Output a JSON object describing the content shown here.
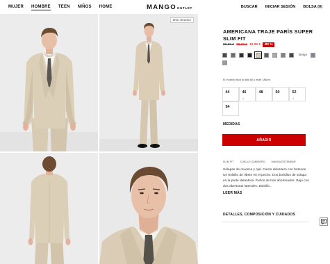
{
  "header": {
    "nav": [
      "MUJER",
      "HOMBRE",
      "TEEN",
      "NIÑOS",
      "HOME"
    ],
    "active_nav": "HOMBRE",
    "logo": "MANGO",
    "logo_suffix": "OUTLET",
    "search": "BUSCAR",
    "login": "INICIAR SESIÓN",
    "bag": "BOLSA (0)"
  },
  "gallery": {
    "badge": "BRID VENDIDO"
  },
  "product": {
    "title": "AMERICANA TRAJE PARÍS SUPER SLIM FIT",
    "price_original": "99,99 €",
    "price_previous": "79,99 €",
    "price_current": "19,99 €",
    "discount": "-80 %",
    "colors": [
      "#4a4a4a",
      "#6f6f6f",
      "#2b2f3a",
      "#1c1c1c",
      "#d9c9ad",
      "#5b5f68",
      "#a8a9ad",
      "#8c7f73",
      "#3d4352",
      "#7d8a93",
      "#9a9aa2"
    ],
    "selected_color_index": 4,
    "color_name": "Beige",
    "model_note": "El modelo lleva la talla 60 y mide 186cm.",
    "sizes": [
      {
        "label": "44",
        "dot": ""
      },
      {
        "label": "46",
        "dot": "•"
      },
      {
        "label": "48",
        "dot": ""
      },
      {
        "label": "50",
        "dot": ""
      },
      {
        "label": "52",
        "dot": "•"
      },
      {
        "label": "54",
        "dot": ""
      }
    ],
    "measures": "MEDIDAS",
    "add_button": "AÑADIR",
    "tags": [
      "SLIM FIT",
      "CUELLO CAMISERO",
      "MANGA ESTÁNDAR"
    ],
    "description": "Solapas de muesca y ojal. Cierre delantero con botones. Un bolsillo de ribete en el pecho. Dos bolsillos de solapa en la parte delantera. Puños de tres abotonados. Bajo con dos aberturas laterales. Bolsillo...",
    "read_more": "LEER MÁS",
    "details": "DETALLES, COMPOSICIÓN Y CUIDADOS"
  }
}
